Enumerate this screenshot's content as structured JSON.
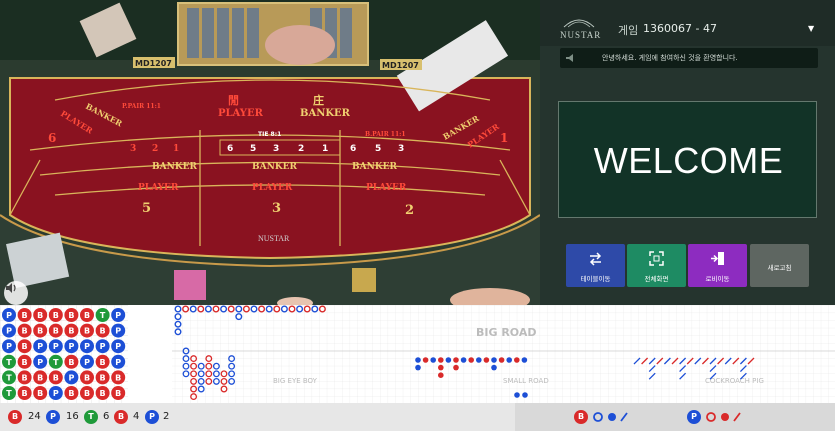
{
  "table": {
    "chinese_player": "閒",
    "chinese_banker": "庄",
    "player": "PLAYER",
    "banker": "BANKER",
    "tie": "TIE 8:1",
    "p_pair": "P.PAIR 11:1",
    "b_pair": "B.PAIR 11:1",
    "limit_left": "MD1207",
    "limit_right": "MD1207",
    "logo": "NUSTAR",
    "box_numbers": [
      "6",
      "5",
      "3",
      "2",
      "1"
    ],
    "seat_numbers": [
      "6",
      "5",
      "3",
      "2",
      "1"
    ]
  },
  "panel": {
    "logo_text": "NUSTAR",
    "game_label": "게임",
    "game_id": "1360067 - 47",
    "notice": "안녕하세요. 게임에 참여하신 것을 환영합니다.",
    "welcome": "WELCOME",
    "buttons": {
      "table_move": "테이블이동",
      "full_screen": "전체화면",
      "lobby": "로비이동",
      "refresh": "새로고침"
    }
  },
  "roads": {
    "big_road": "BIG ROAD",
    "big_eye_boy": "BIG EYE BOY",
    "small_road": "SMALL ROAD",
    "cockroach_pig": "COCKROACH PIG",
    "bead_plate": [
      [
        "P",
        "P",
        "P",
        "T",
        "T",
        "T"
      ],
      [
        "B",
        "B",
        "B",
        "B",
        "B",
        "B"
      ],
      [
        "B",
        "B",
        "P",
        "P",
        "B",
        "B"
      ],
      [
        "B",
        "B",
        "P",
        "T",
        "B",
        "P"
      ],
      [
        "B",
        "B",
        "P",
        "B",
        "P",
        "B"
      ],
      [
        "B",
        "B",
        "P",
        "P",
        "B",
        "B"
      ],
      [
        "T",
        "B",
        "P",
        "B",
        "B",
        "B"
      ],
      [
        "P",
        "P",
        "P",
        "P",
        "B",
        "B"
      ]
    ],
    "colors": {
      "banker": "#d92a2a",
      "player": "#1d4fd6",
      "tie": "#1f9a3a"
    }
  },
  "stats": {
    "banker_label": "B",
    "banker_count": "24",
    "player_label": "P",
    "player_count": "16",
    "tie_label": "T",
    "tie_count": "6",
    "bpair_label": "B",
    "bpair_count": "4",
    "ppair_label": "P",
    "ppair_count": "2"
  },
  "predict": {
    "banker_label": "B",
    "player_label": "P"
  }
}
